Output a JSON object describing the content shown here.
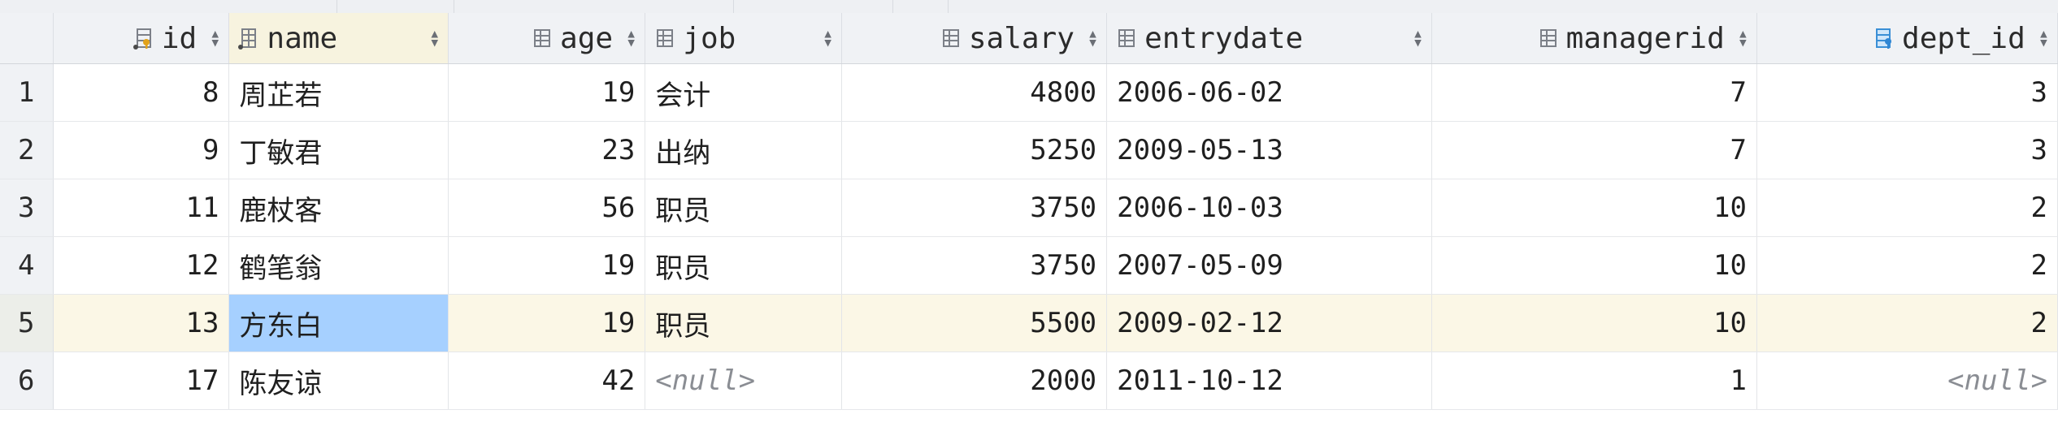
{
  "columns": [
    {
      "key": "rownum",
      "label": ""
    },
    {
      "key": "id",
      "label": "id",
      "icon": "primary-key-column-icon"
    },
    {
      "key": "name",
      "label": "name",
      "icon": "indexed-column-icon"
    },
    {
      "key": "age",
      "label": "age",
      "icon": "column-icon"
    },
    {
      "key": "job",
      "label": "job",
      "icon": "column-icon"
    },
    {
      "key": "salary",
      "label": "salary",
      "icon": "column-icon"
    },
    {
      "key": "entrydate",
      "label": "entrydate",
      "icon": "column-icon"
    },
    {
      "key": "managerid",
      "label": "managerid",
      "icon": "column-icon"
    },
    {
      "key": "dept_id",
      "label": "dept_id",
      "icon": "foreign-key-column-icon"
    }
  ],
  "rows": [
    {
      "rownum": "1",
      "id": "8",
      "name": "周芷若",
      "age": "19",
      "job": "会计",
      "salary": "4800",
      "entrydate": "2006-06-02",
      "managerid": "7",
      "dept_id": "3"
    },
    {
      "rownum": "2",
      "id": "9",
      "name": "丁敏君",
      "age": "23",
      "job": "出纳",
      "salary": "5250",
      "entrydate": "2009-05-13",
      "managerid": "7",
      "dept_id": "3"
    },
    {
      "rownum": "3",
      "id": "11",
      "name": "鹿杖客",
      "age": "56",
      "job": "职员",
      "salary": "3750",
      "entrydate": "2006-10-03",
      "managerid": "10",
      "dept_id": "2"
    },
    {
      "rownum": "4",
      "id": "12",
      "name": "鹤笔翁",
      "age": "19",
      "job": "职员",
      "salary": "3750",
      "entrydate": "2007-05-09",
      "managerid": "10",
      "dept_id": "2"
    },
    {
      "rownum": "5",
      "id": "13",
      "name": "方东白",
      "age": "19",
      "job": "职员",
      "salary": "5500",
      "entrydate": "2009-02-12",
      "managerid": "10",
      "dept_id": "2"
    },
    {
      "rownum": "6",
      "id": "17",
      "name": "陈友谅",
      "age": "42",
      "job": "<null>",
      "salary": "2000",
      "entrydate": "2011-10-12",
      "managerid": "1",
      "dept_id": "<null>"
    }
  ],
  "selected_row": 5,
  "active_cell": {
    "row": 5,
    "column": "name"
  },
  "colors": {
    "header_bg": "#f0f2f5",
    "selected_row_bg": "#fbf7e6",
    "active_cell_bg": "#a6d0ff",
    "null_text": "#8a8d93"
  }
}
